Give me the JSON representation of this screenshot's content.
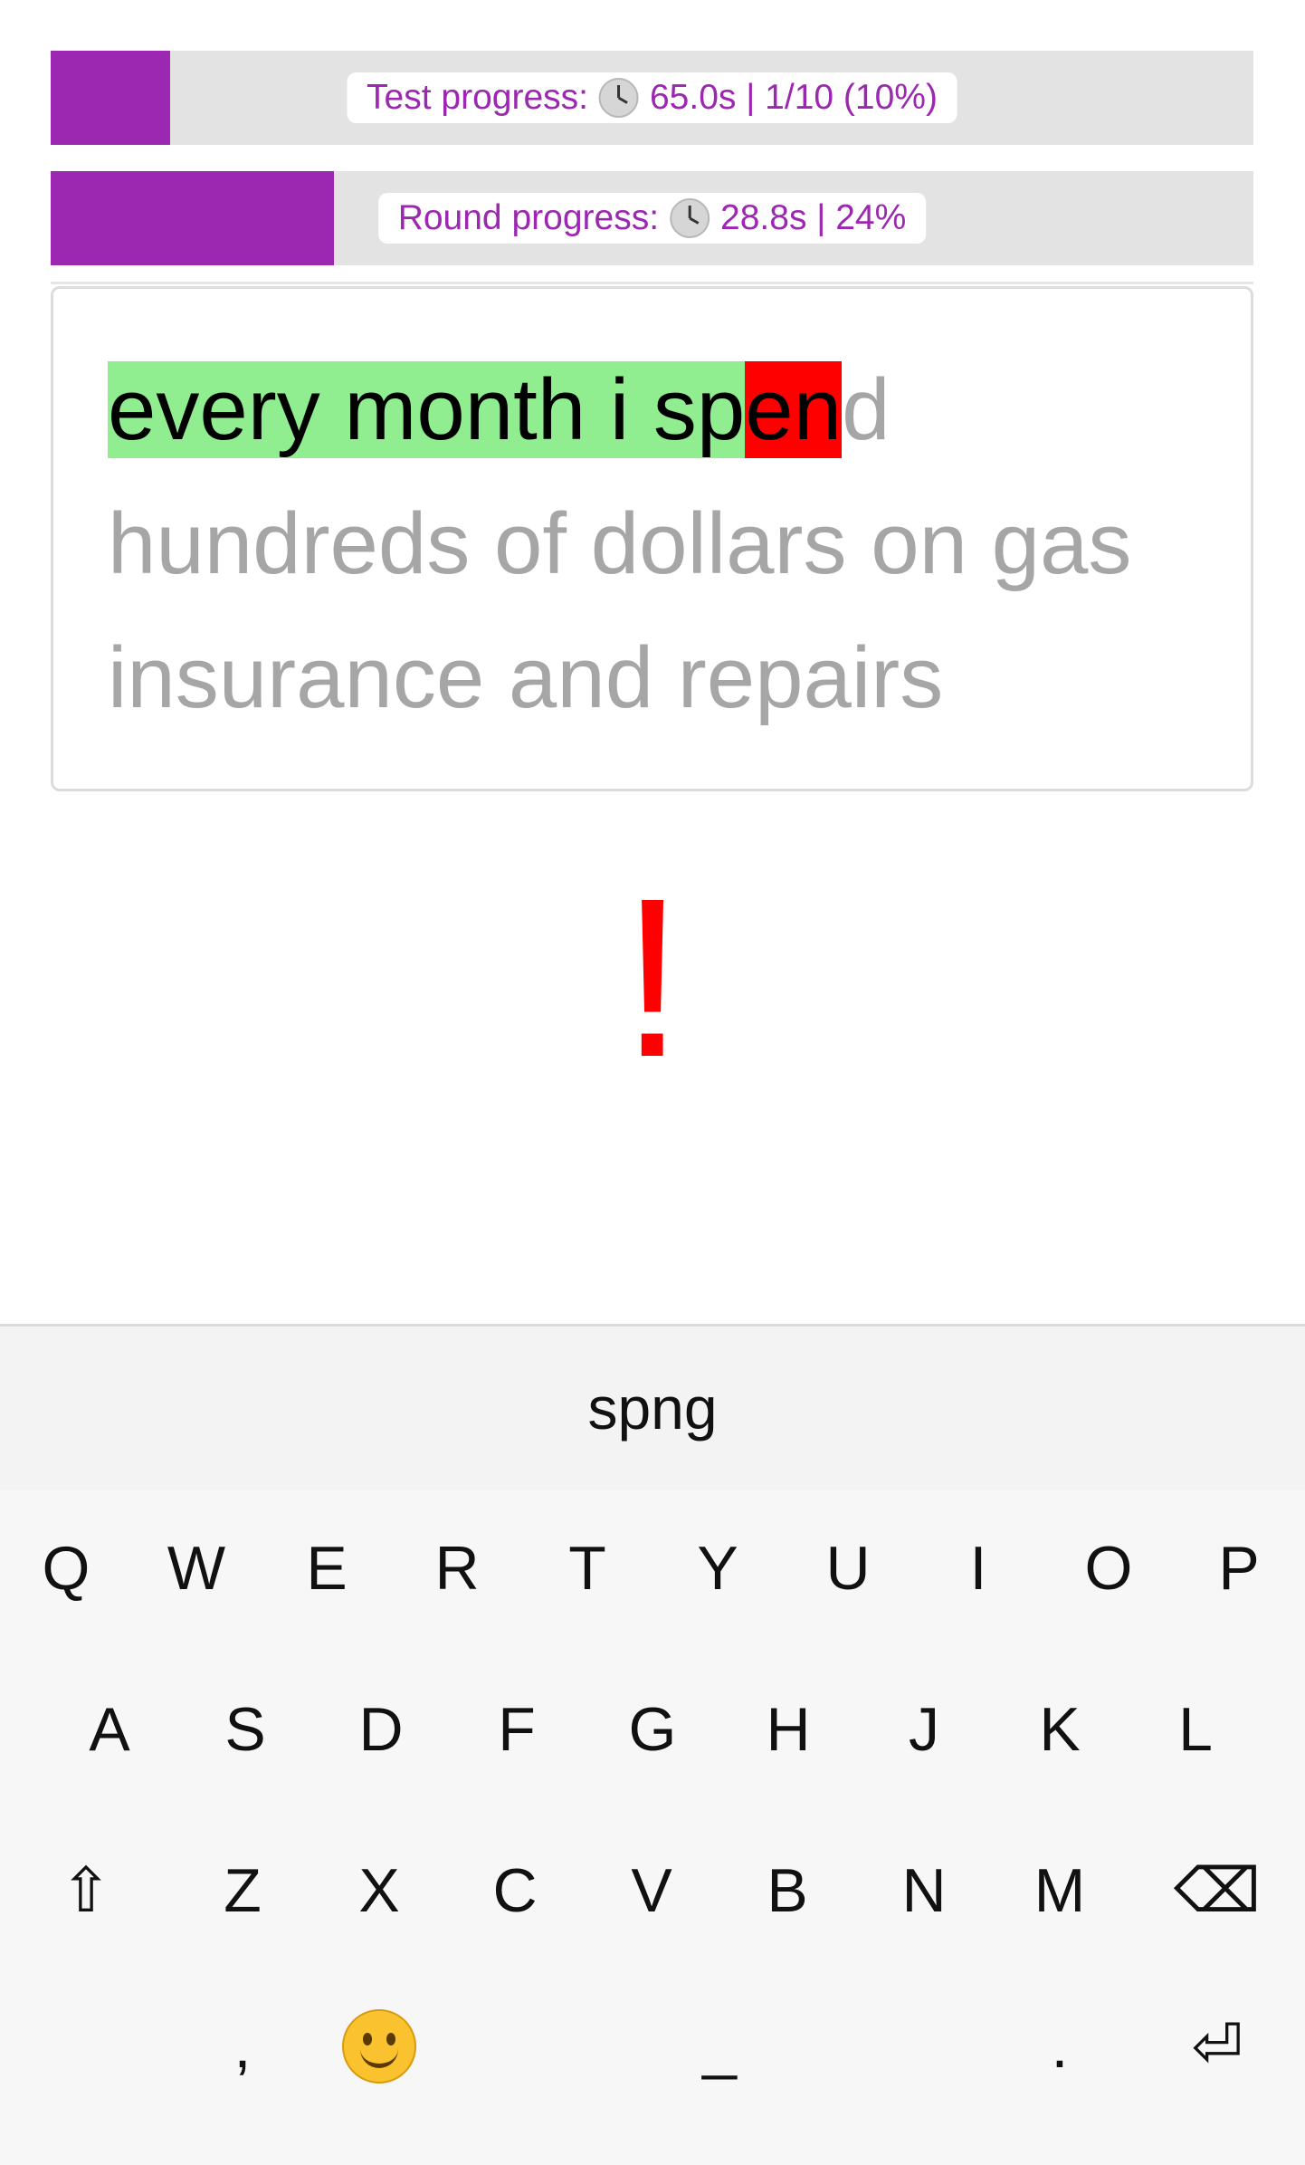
{
  "test_progress": {
    "label_prefix": "Test progress:",
    "label_value": "65.0s | 1/10 (10%)",
    "fraction": 0.1
  },
  "round_progress": {
    "label_prefix": "Round progress:",
    "label_value": "28.8s | 24%",
    "fraction": 0.24
  },
  "phrase": {
    "correct": "every month i sp",
    "wrong": "en",
    "remaining": "d hundreds of dollars on gas insurance and repairs"
  },
  "error_mark": "!",
  "keyboard": {
    "suggestion": "spng",
    "row1": [
      "Q",
      "W",
      "E",
      "R",
      "T",
      "Y",
      "U",
      "I",
      "O",
      "P"
    ],
    "row2": [
      "A",
      "S",
      "D",
      "F",
      "G",
      "H",
      "J",
      "K",
      "L"
    ],
    "row3": [
      "Z",
      "X",
      "C",
      "V",
      "B",
      "N",
      "M"
    ],
    "shift": "⇧",
    "backspace": "⌫",
    "comma": ",",
    "space": "_",
    "period": ".",
    "enter": "⏎"
  },
  "colors": {
    "accent": "#9c27b0",
    "correct": "#90ee90",
    "wrong": "#ff0000"
  }
}
